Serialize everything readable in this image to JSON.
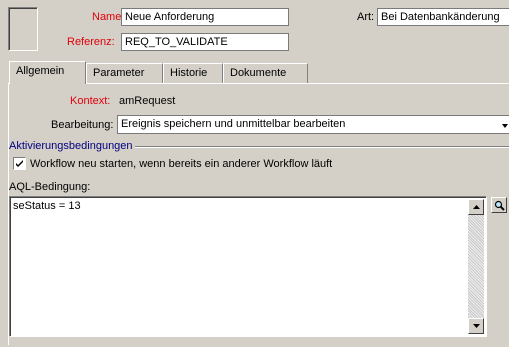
{
  "header": {
    "name_label": "Name:",
    "name_value": "Neue Anforderung",
    "referenz_label": "Referenz:",
    "referenz_value": "REQ_TO_VALIDATE",
    "art_label": "Art:",
    "art_value": "Bei Datenbankänderung"
  },
  "tabs": [
    {
      "label": "Allgemein",
      "active": true
    },
    {
      "label": "Parameter",
      "active": false
    },
    {
      "label": "Historie",
      "active": false
    },
    {
      "label": "Dokumente",
      "active": false
    }
  ],
  "general": {
    "kontext_label": "Kontext:",
    "kontext_value": "amRequest",
    "bearbeitung_label": "Bearbeitung:",
    "bearbeitung_value": "Ereignis speichern und unmittelbar bearbeiten",
    "group_title": "Aktivierungsbedingungen",
    "checkbox_label": "Workflow neu starten, wenn bereits ein anderer Workflow läuft",
    "checkbox_checked": true,
    "aql_label": "AQL-Bedingung:",
    "aql_value": "seStatus = 13"
  },
  "icons": [
    "scroll-up-icon",
    "scroll-down-icon",
    "magnifier-icon",
    "dropdown-arrow-icon"
  ],
  "colors": {
    "label_red": "#e0000a",
    "window_bg": "#d4d0c8",
    "group_title_blue": "#000080"
  }
}
